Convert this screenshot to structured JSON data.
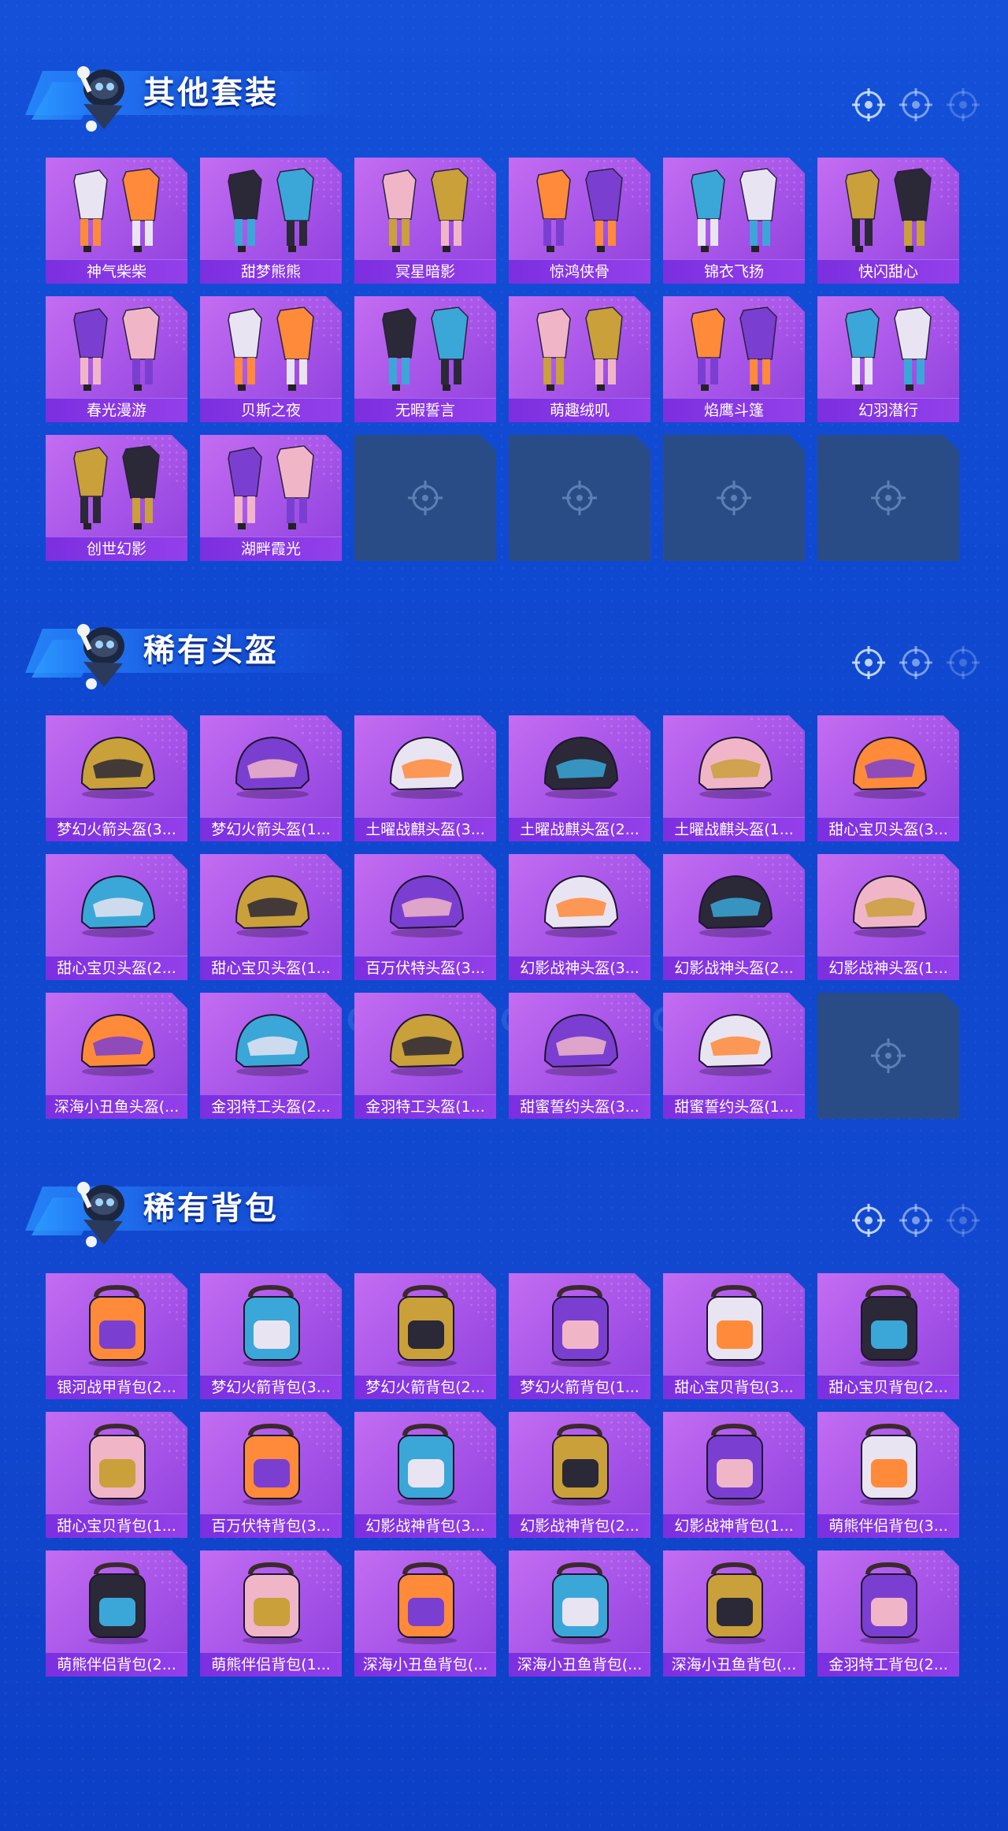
{
  "colors": {
    "background": "#1248d0",
    "tile_purple": "#a654e8",
    "label_purple": "#8a38e6",
    "empty_slot": "#2a4c86"
  },
  "watermark": "GAME FOR PEACE",
  "sections": [
    {
      "title": "其他套装",
      "items": [
        {
          "label": "神气柴柴",
          "icon": "outfit-icon"
        },
        {
          "label": "甜梦熊熊",
          "icon": "outfit-icon"
        },
        {
          "label": "冥星暗影",
          "icon": "outfit-icon"
        },
        {
          "label": "惊鸿侠骨",
          "icon": "outfit-icon"
        },
        {
          "label": "锦衣飞扬",
          "icon": "outfit-icon"
        },
        {
          "label": "快闪甜心",
          "icon": "outfit-icon"
        },
        {
          "label": "春光漫游",
          "icon": "outfit-icon"
        },
        {
          "label": "贝斯之夜",
          "icon": "outfit-icon"
        },
        {
          "label": "无暇誓言",
          "icon": "outfit-icon"
        },
        {
          "label": "萌趣绒叽",
          "icon": "outfit-icon"
        },
        {
          "label": "焰鹰斗篷",
          "icon": "outfit-icon"
        },
        {
          "label": "幻羽潜行",
          "icon": "outfit-icon"
        },
        {
          "label": "创世幻影",
          "icon": "outfit-icon"
        },
        {
          "label": "湖畔霞光",
          "icon": "outfit-icon"
        }
      ],
      "empty_slots": 4
    },
    {
      "title": "稀有头盔",
      "items": [
        {
          "label": "梦幻火箭头盔(3...",
          "icon": "helmet-icon"
        },
        {
          "label": "梦幻火箭头盔(1...",
          "icon": "helmet-icon"
        },
        {
          "label": "土曜战麒头盔(3...",
          "icon": "helmet-icon"
        },
        {
          "label": "土曜战麒头盔(2...",
          "icon": "helmet-icon"
        },
        {
          "label": "土曜战麒头盔(1...",
          "icon": "helmet-icon"
        },
        {
          "label": "甜心宝贝头盔(3...",
          "icon": "helmet-icon"
        },
        {
          "label": "甜心宝贝头盔(2...",
          "icon": "helmet-icon"
        },
        {
          "label": "甜心宝贝头盔(1...",
          "icon": "helmet-icon"
        },
        {
          "label": "百万伏特头盔(3...",
          "icon": "helmet-icon"
        },
        {
          "label": "幻影战神头盔(3...",
          "icon": "helmet-icon"
        },
        {
          "label": "幻影战神头盔(2...",
          "icon": "helmet-icon"
        },
        {
          "label": "幻影战神头盔(1...",
          "icon": "helmet-icon"
        },
        {
          "label": "深海小丑鱼头盔(...",
          "icon": "helmet-icon"
        },
        {
          "label": "金羽特工头盔(2...",
          "icon": "helmet-icon"
        },
        {
          "label": "金羽特工头盔(1...",
          "icon": "helmet-icon"
        },
        {
          "label": "甜蜜誓约头盔(3...",
          "icon": "helmet-icon"
        },
        {
          "label": "甜蜜誓约头盔(1...",
          "icon": "helmet-icon"
        }
      ],
      "empty_slots": 1
    },
    {
      "title": "稀有背包",
      "items": [
        {
          "label": "银河战甲背包(2...",
          "icon": "backpack-icon"
        },
        {
          "label": "梦幻火箭背包(3...",
          "icon": "backpack-icon"
        },
        {
          "label": "梦幻火箭背包(2...",
          "icon": "backpack-icon"
        },
        {
          "label": "梦幻火箭背包(1...",
          "icon": "backpack-icon"
        },
        {
          "label": "甜心宝贝背包(3...",
          "icon": "backpack-icon"
        },
        {
          "label": "甜心宝贝背包(2...",
          "icon": "backpack-icon"
        },
        {
          "label": "甜心宝贝背包(1...",
          "icon": "backpack-icon"
        },
        {
          "label": "百万伏特背包(3...",
          "icon": "backpack-icon"
        },
        {
          "label": "幻影战神背包(3...",
          "icon": "backpack-icon"
        },
        {
          "label": "幻影战神背包(2...",
          "icon": "backpack-icon"
        },
        {
          "label": "幻影战神背包(1...",
          "icon": "backpack-icon"
        },
        {
          "label": "萌熊伴侣背包(3...",
          "icon": "backpack-icon"
        },
        {
          "label": "萌熊伴侣背包(2...",
          "icon": "backpack-icon"
        },
        {
          "label": "萌熊伴侣背包(1...",
          "icon": "backpack-icon"
        },
        {
          "label": "深海小丑鱼背包(...",
          "icon": "backpack-icon"
        },
        {
          "label": "深海小丑鱼背包(...",
          "icon": "backpack-icon"
        },
        {
          "label": "深海小丑鱼背包(...",
          "icon": "backpack-icon"
        },
        {
          "label": "金羽特工背包(2...",
          "icon": "backpack-icon"
        }
      ],
      "empty_slots": 0
    }
  ]
}
